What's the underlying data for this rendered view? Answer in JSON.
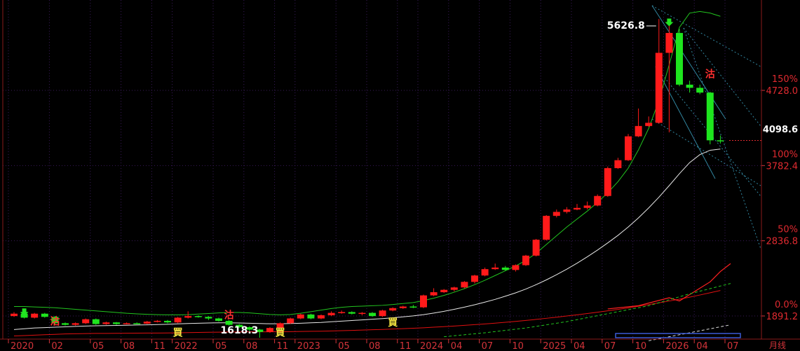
{
  "chart_data": {
    "type": "candlestick",
    "period_label": "月线",
    "price_range": [
      1400,
      5800
    ],
    "price_ticks": [
      {
        "label": "4728.0",
        "value": 4728.0
      },
      {
        "label": "3782.4",
        "value": 3782.4
      },
      {
        "label": "2836.8",
        "value": 2836.8
      },
      {
        "label": "1891.2",
        "value": 1891.2
      }
    ],
    "percent_ticks": [
      {
        "label": "150%",
        "value": 4728.0
      },
      {
        "label": "100%",
        "value": 3782.4
      },
      {
        "label": "50%",
        "value": 2836.8
      },
      {
        "label": "0.0%",
        "value": 1891.2
      }
    ],
    "last_price_label": "4098.6",
    "last_price": 4098.6,
    "x_ticks": [
      {
        "label": "2020",
        "index": 0
      },
      {
        "label": "02",
        "index": 4
      },
      {
        "label": "05",
        "index": 8
      },
      {
        "label": "08",
        "index": 11
      },
      {
        "label": "11",
        "index": 14
      },
      {
        "label": "2022",
        "index": 16
      },
      {
        "label": "05",
        "index": 20
      },
      {
        "label": "08",
        "index": 23
      },
      {
        "label": "11",
        "index": 26
      },
      {
        "label": "2023",
        "index": 28
      },
      {
        "label": "05",
        "index": 32
      },
      {
        "label": "08",
        "index": 35
      },
      {
        "label": "11",
        "index": 38
      },
      {
        "label": "2024",
        "index": 40
      },
      {
        "label": "04",
        "index": 43
      },
      {
        "label": "07",
        "index": 46
      },
      {
        "label": "10",
        "index": 49
      },
      {
        "label": "2025",
        "index": 52
      },
      {
        "label": "04",
        "index": 55
      },
      {
        "label": "07",
        "index": 58
      },
      {
        "label": "10",
        "index": 61
      },
      {
        "label": "2026",
        "index": 64
      },
      {
        "label": "04",
        "index": 67
      },
      {
        "label": "07",
        "index": 70
      }
    ],
    "high_annotation": {
      "label": "5626.8",
      "index": 63,
      "value": 5626.8
    },
    "low_annotation": {
      "label": "1618.3",
      "index": 24,
      "value": 1618.3
    },
    "signals": [
      {
        "text": "買",
        "index": 16,
        "value": 1640
      },
      {
        "text": "買",
        "index": 26,
        "value": 1640
      },
      {
        "text": "買",
        "index": 37,
        "value": 1770
      },
      {
        "text": "沽",
        "index": 21,
        "value": 1860
      },
      {
        "text": "沽",
        "index": 4,
        "value": 1780
      },
      {
        "text": "沽",
        "index": 68,
        "value": 4890
      }
    ],
    "candles": [
      [
        1890,
        1920,
        1940,
        1880
      ],
      [
        1920,
        1870,
        1930,
        1860
      ],
      [
        1870,
        1920,
        1930,
        1860
      ],
      [
        1920,
        1880,
        1930,
        1870
      ],
      [
        1880,
        1800,
        1890,
        1780
      ],
      [
        1800,
        1780,
        1810,
        1770
      ],
      [
        1780,
        1800,
        1810,
        1770
      ],
      [
        1800,
        1850,
        1860,
        1790
      ],
      [
        1850,
        1790,
        1860,
        1780
      ],
      [
        1790,
        1810,
        1820,
        1780
      ],
      [
        1810,
        1790,
        1815,
        1780
      ],
      [
        1790,
        1800,
        1810,
        1785
      ],
      [
        1800,
        1795,
        1810,
        1790
      ],
      [
        1795,
        1820,
        1830,
        1790
      ],
      [
        1820,
        1830,
        1840,
        1810
      ],
      [
        1830,
        1810,
        1840,
        1800
      ],
      [
        1810,
        1870,
        1880,
        1800
      ],
      [
        1870,
        1890,
        1950,
        1860
      ],
      [
        1890,
        1880,
        1900,
        1870
      ],
      [
        1880,
        1860,
        1890,
        1840
      ],
      [
        1860,
        1830,
        1870,
        1820
      ],
      [
        1830,
        1780,
        1840,
        1770
      ],
      [
        1780,
        1750,
        1790,
        1740
      ],
      [
        1750,
        1720,
        1760,
        1700
      ],
      [
        1720,
        1690,
        1730,
        1618
      ],
      [
        1690,
        1740,
        1750,
        1680
      ],
      [
        1740,
        1800,
        1810,
        1730
      ],
      [
        1800,
        1860,
        1870,
        1790
      ],
      [
        1860,
        1910,
        1920,
        1850
      ],
      [
        1910,
        1860,
        1920,
        1850
      ],
      [
        1860,
        1900,
        1910,
        1850
      ],
      [
        1900,
        1930,
        1950,
        1890
      ],
      [
        1930,
        1940,
        1960,
        1920
      ],
      [
        1940,
        1920,
        1950,
        1910
      ],
      [
        1920,
        1930,
        1940,
        1900
      ],
      [
        1930,
        1890,
        1940,
        1880
      ],
      [
        1890,
        1960,
        1970,
        1880
      ],
      [
        1960,
        1990,
        2000,
        1950
      ],
      [
        1990,
        2010,
        2020,
        1980
      ],
      [
        2010,
        2000,
        2030,
        1990
      ],
      [
        2000,
        2150,
        2160,
        1990
      ],
      [
        2150,
        2190,
        2240,
        2140
      ],
      [
        2190,
        2220,
        2230,
        2180
      ],
      [
        2220,
        2250,
        2260,
        2200
      ],
      [
        2250,
        2320,
        2330,
        2240
      ],
      [
        2320,
        2400,
        2410,
        2300
      ],
      [
        2400,
        2480,
        2500,
        2390
      ],
      [
        2480,
        2500,
        2550,
        2470
      ],
      [
        2500,
        2470,
        2520,
        2460
      ],
      [
        2470,
        2530,
        2540,
        2450
      ],
      [
        2530,
        2650,
        2660,
        2520
      ],
      [
        2650,
        2850,
        2860,
        2640
      ],
      [
        2850,
        3150,
        3160,
        2840
      ],
      [
        3150,
        3200,
        3230,
        3130
      ],
      [
        3200,
        3230,
        3260,
        3180
      ],
      [
        3230,
        3250,
        3300,
        3220
      ],
      [
        3250,
        3280,
        3330,
        3230
      ],
      [
        3280,
        3400,
        3420,
        3270
      ],
      [
        3400,
        3750,
        3770,
        3390
      ],
      [
        3750,
        3850,
        3880,
        3740
      ],
      [
        3850,
        4150,
        4180,
        3840
      ],
      [
        4150,
        4280,
        4500,
        4140
      ],
      [
        4280,
        4320,
        4400,
        4270
      ],
      [
        4320,
        5200,
        5626,
        4310
      ],
      [
        5200,
        5450,
        5550,
        4200
      ],
      [
        5450,
        4800,
        5500,
        4780
      ],
      [
        4800,
        4760,
        4850,
        4700
      ],
      [
        4760,
        4700,
        4800,
        4680
      ],
      [
        4700,
        4100,
        4710,
        4050
      ],
      [
        4100,
        4098.6,
        4160,
        4060
      ]
    ],
    "upper_band": [
      2010,
      2010,
      2005,
      2000,
      1995,
      1985,
      1975,
      1965,
      1955,
      1945,
      1935,
      1925,
      1918,
      1912,
      1908,
      1905,
      1905,
      1908,
      1915,
      1922,
      1930,
      1935,
      1935,
      1930,
      1920,
      1910,
      1905,
      1910,
      1925,
      1945,
      1965,
      1985,
      2000,
      2010,
      2015,
      2020,
      2025,
      2035,
      2048,
      2060,
      2085,
      2115,
      2150,
      2190,
      2235,
      2285,
      2340,
      2400,
      2460,
      2520,
      2590,
      2680,
      2790,
      2900,
      3010,
      3110,
      3210,
      3320,
      3440,
      3580,
      3750,
      3980,
      4250,
      4600,
      5050,
      5520,
      5700,
      5720,
      5700,
      5660
    ],
    "white_ma": [
      1720,
      1730,
      1740,
      1745,
      1750,
      1755,
      1760,
      1765,
      1768,
      1770,
      1772,
      1775,
      1778,
      1780,
      1783,
      1787,
      1792,
      1796,
      1800,
      1803,
      1805,
      1805,
      1803,
      1800,
      1796,
      1793,
      1793,
      1796,
      1800,
      1805,
      1810,
      1818,
      1826,
      1834,
      1842,
      1850,
      1858,
      1868,
      1880,
      1892,
      1908,
      1928,
      1950,
      1975,
      2002,
      2032,
      2065,
      2100,
      2140,
      2182,
      2230,
      2285,
      2345,
      2410,
      2480,
      2555,
      2635,
      2720,
      2810,
      2905,
      3010,
      3125,
      3250,
      3385,
      3530,
      3680,
      3820,
      3920,
      3975,
      3990
    ],
    "red_ma": [
      1640,
      1645,
      1650,
      1655,
      1660,
      1665,
      1668,
      1670,
      1672,
      1672,
      1673,
      1674,
      1675,
      1676,
      1677,
      1678,
      1680,
      1682,
      1684,
      1686,
      1688,
      1690,
      1691,
      1692,
      1692,
      1692,
      1693,
      1694,
      1696,
      1698,
      1700,
      1703,
      1706,
      1710,
      1714,
      1718,
      1722,
      1727,
      1732,
      1737,
      1743,
      1750,
      1757,
      1765,
      1773,
      1782,
      1791,
      1801,
      1812,
      1823,
      1835,
      1848,
      1862,
      1876,
      1891,
      1906,
      1922,
      1939,
      1956,
      1974,
      1993,
      2013,
      2034,
      2056,
      2079,
      2103,
      2128,
      2155,
      2183,
      2212
    ],
    "red_ma_recent": [
      [
        58,
        1980
      ],
      [
        61,
        2020
      ],
      [
        64,
        2120
      ],
      [
        65,
        2080
      ],
      [
        66,
        2160
      ],
      [
        67,
        2240
      ],
      [
        68,
        2320
      ],
      [
        69,
        2450
      ],
      [
        70,
        2550
      ]
    ],
    "green_dashed_ma": [
      [
        42,
        1630
      ],
      [
        46,
        1680
      ],
      [
        50,
        1740
      ],
      [
        54,
        1820
      ],
      [
        58,
        1920
      ],
      [
        62,
        2020
      ],
      [
        66,
        2170
      ],
      [
        70,
        2300
      ]
    ],
    "white_dashed_ma": [
      [
        62,
        1580
      ],
      [
        66,
        1680
      ],
      [
        70,
        1780
      ]
    ]
  }
}
